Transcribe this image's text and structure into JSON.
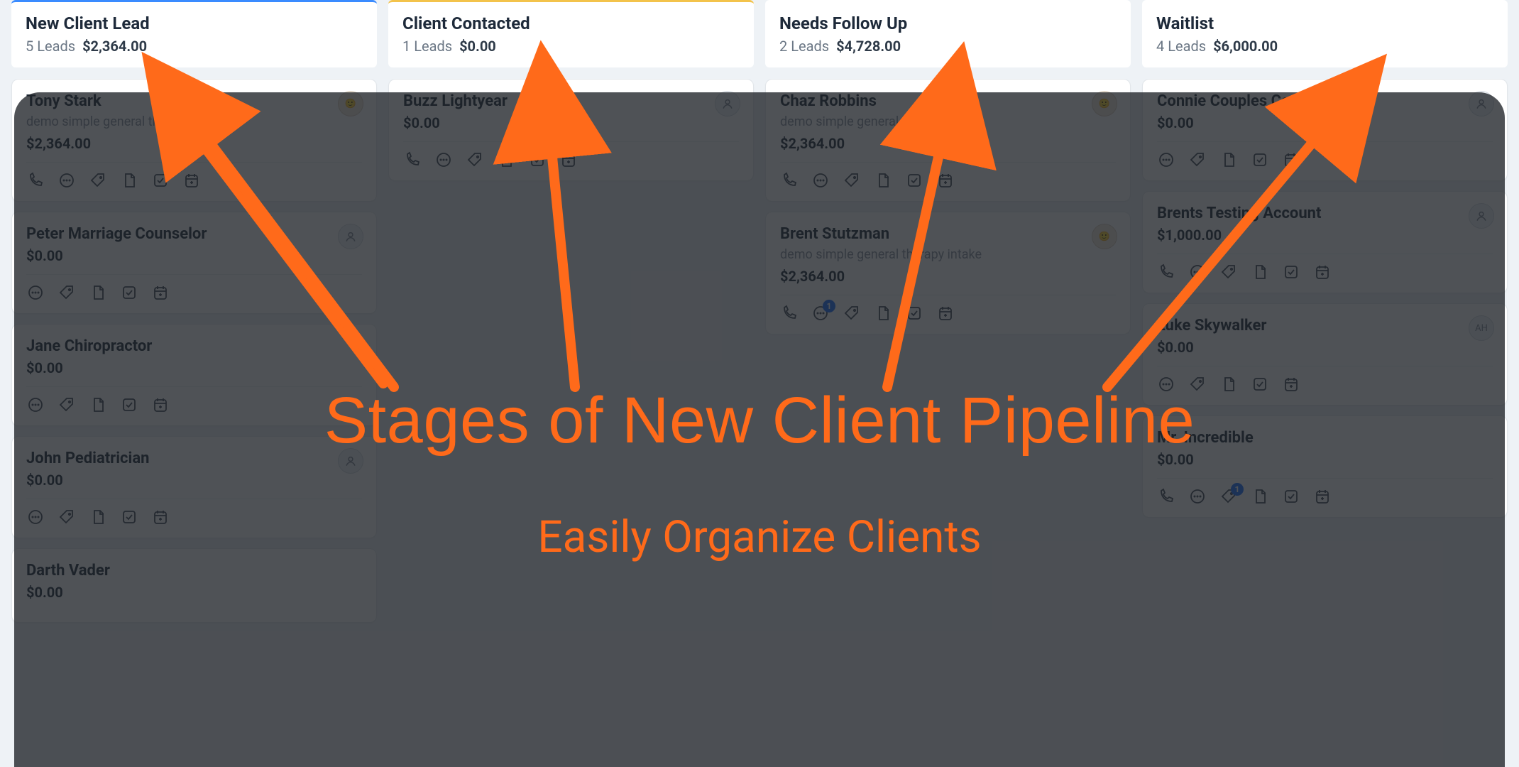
{
  "annotations": {
    "title": "Stages of New Client Pipeline",
    "subtitle": "Easily Organize Clients"
  },
  "columns": [
    {
      "title": "New Client Lead",
      "leads_label": "5 Leads",
      "amount": "$2,364.00",
      "border": "blue",
      "cards": [
        {
          "name": "Tony Stark",
          "desc": "demo simple general therapy intake",
          "amount": "$2,364.00",
          "avatar": "photo",
          "icons": [
            "phone",
            "chat",
            "tag",
            "doc",
            "check",
            "cal"
          ]
        },
        {
          "name": "Peter Marriage Counselor",
          "desc": "",
          "amount": "$0.00",
          "avatar": "generic",
          "icons": [
            "chat",
            "tag",
            "doc",
            "check",
            "cal"
          ]
        },
        {
          "name": "Jane Chiropractor",
          "desc": "",
          "amount": "$0.00",
          "avatar": "",
          "icons": [
            "chat",
            "tag",
            "doc",
            "check",
            "cal"
          ]
        },
        {
          "name": "John Pediatrician",
          "desc": "",
          "amount": "$0.00",
          "avatar": "generic",
          "icons": [
            "chat",
            "tag",
            "doc",
            "check",
            "cal"
          ]
        },
        {
          "name": "Darth Vader",
          "desc": "",
          "amount": "$0.00",
          "avatar": "",
          "icons": []
        }
      ]
    },
    {
      "title": "Client Contacted",
      "leads_label": "1 Leads",
      "amount": "$0.00",
      "border": "yellow",
      "cards": [
        {
          "name": "Buzz Lightyear",
          "desc": "",
          "amount": "$0.00",
          "avatar": "generic",
          "icons": [
            "phone",
            "chat",
            "tag",
            "doc",
            "check",
            "cal"
          ]
        }
      ]
    },
    {
      "title": "Needs Follow Up",
      "leads_label": "2 Leads",
      "amount": "$4,728.00",
      "border": "",
      "cards": [
        {
          "name": "Chaz Robbins",
          "desc": "demo simple general therapy intake",
          "amount": "$2,364.00",
          "avatar": "photo",
          "icons": [
            "phone",
            "chat",
            "tag",
            "doc",
            "check",
            "cal"
          ]
        },
        {
          "name": "Brent Stutzman",
          "desc": "demo simple general therapy intake",
          "amount": "$2,364.00",
          "avatar": "photo",
          "icons": [
            "phone",
            "chat",
            "tag",
            "doc",
            "check",
            "cal"
          ],
          "badge_on": "chat",
          "badge": "1"
        }
      ]
    },
    {
      "title": "Waitlist",
      "leads_label": "4 Leads",
      "amount": "$6,000.00",
      "border": "",
      "cards": [
        {
          "name": "Connie Couples Counseling",
          "desc": "",
          "amount": "$0.00",
          "avatar": "generic",
          "icons": [
            "chat",
            "tag",
            "doc",
            "check",
            "cal"
          ]
        },
        {
          "name": "Brents Testing Account",
          "desc": "",
          "amount": "$1,000.00",
          "avatar": "generic",
          "icons": [
            "phone",
            "chat",
            "tag",
            "doc",
            "check",
            "cal"
          ]
        },
        {
          "name": "Luke Skywalker",
          "desc": "",
          "amount": "$0.00",
          "avatar": "initials",
          "initials": "AH",
          "icons": [
            "chat",
            "tag",
            "doc",
            "check",
            "cal"
          ]
        },
        {
          "name": "Mr. Incredible",
          "desc": "",
          "amount": "$0.00",
          "avatar": "",
          "icons": [
            "phone",
            "chat",
            "tag",
            "doc",
            "check",
            "cal"
          ],
          "badge_on": "tag",
          "badge": "1"
        }
      ]
    }
  ],
  "icon_names": {
    "phone": "phone-icon",
    "chat": "chat-icon",
    "tag": "tag-icon",
    "doc": "document-icon",
    "check": "task-icon",
    "cal": "calendar-icon"
  }
}
